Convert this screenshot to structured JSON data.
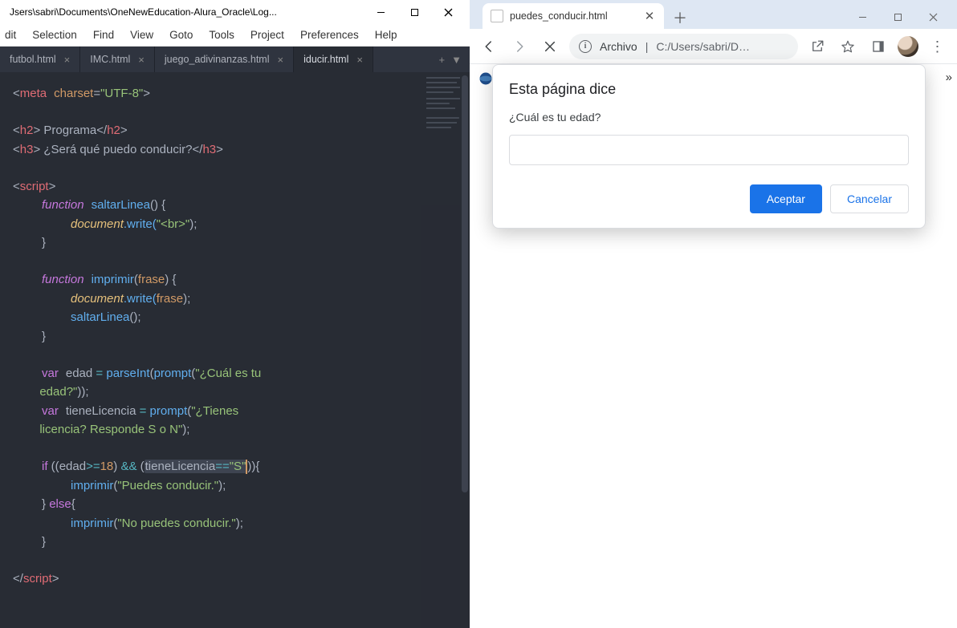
{
  "editor": {
    "title_path": "Jsers\\sabri\\Documents\\OneNewEducation-Alura_Oracle\\Log...",
    "menu": [
      "dit",
      "Selection",
      "Find",
      "View",
      "Goto",
      "Tools",
      "Project",
      "Preferences",
      "Help"
    ],
    "tabs": [
      {
        "label": "futbol.html",
        "active": false
      },
      {
        "label": "IMC.html",
        "active": false
      },
      {
        "label": "juego_adivinanzas.html",
        "active": false
      },
      {
        "label": "iducir.html",
        "active": true
      }
    ],
    "code": {
      "l1": {
        "tag": "meta",
        "attr": "charset",
        "val": "\"UTF-8\""
      },
      "l2": {
        "tag": "h2",
        "text": " Programa"
      },
      "l3": {
        "tag": "h3",
        "text": " ¿Será qué puedo conducir?"
      },
      "script_open": "script",
      "fn1": {
        "kw": "function",
        "name": "saltarLinea",
        "body_obj": "document",
        "body_m": ".write(",
        "body_s": "\"<br>\"",
        "body_end": ");"
      },
      "fn2": {
        "kw": "function",
        "name": "imprimir",
        "param": "frase",
        "b1_obj": "document",
        "b1_m": ".write(",
        "b1_arg": "frase",
        "b1_end": ");",
        "b2_call": "saltarLinea",
        "b2_end": "();"
      },
      "v1": {
        "kw": "var",
        "name": "edad",
        "eq": " = ",
        "fn": "parseInt",
        "open": "(",
        "pr": "prompt",
        "po": "(",
        "s": "\"¿Cuál es tu ",
        "s2": "edad?\"",
        "close": "));"
      },
      "v2": {
        "kw": "var",
        "name": "tieneLicencia",
        "eq": " = ",
        "pr": "prompt",
        "po": "(",
        "s": "\"¿Tienes ",
        "s2": "licencia? Responde S o N\"",
        "close": ");"
      },
      "if": {
        "kw": "if",
        "open": " ((",
        "e": "edad",
        "ge": ">=",
        "n": "18",
        "close1": ") ",
        "and": "&&",
        "open2": " (",
        "tl": "tieneLicencia",
        "eqeq": "==",
        "sS": "\"S\"",
        "close2": ")){",
        "imp": "imprimir",
        "po": "(",
        "s": "\"Puedes conducir.\"",
        "end": ");"
      },
      "else": {
        "close": "}",
        "kw": " else",
        "open": "{",
        "imp": "imprimir",
        "po": "(",
        "s": "\"No puedes conducir.\"",
        "end": ");",
        "cb": "}"
      },
      "script_close": "script"
    }
  },
  "browser": {
    "tab_title": "puedes_conducir.html",
    "addr_label": "Archivo",
    "addr_path": "C:/Users/sabri/D…",
    "dialog": {
      "title": "Esta página dice",
      "prompt": "¿Cuál es tu edad?",
      "accept": "Aceptar",
      "cancel": "Cancelar"
    }
  }
}
